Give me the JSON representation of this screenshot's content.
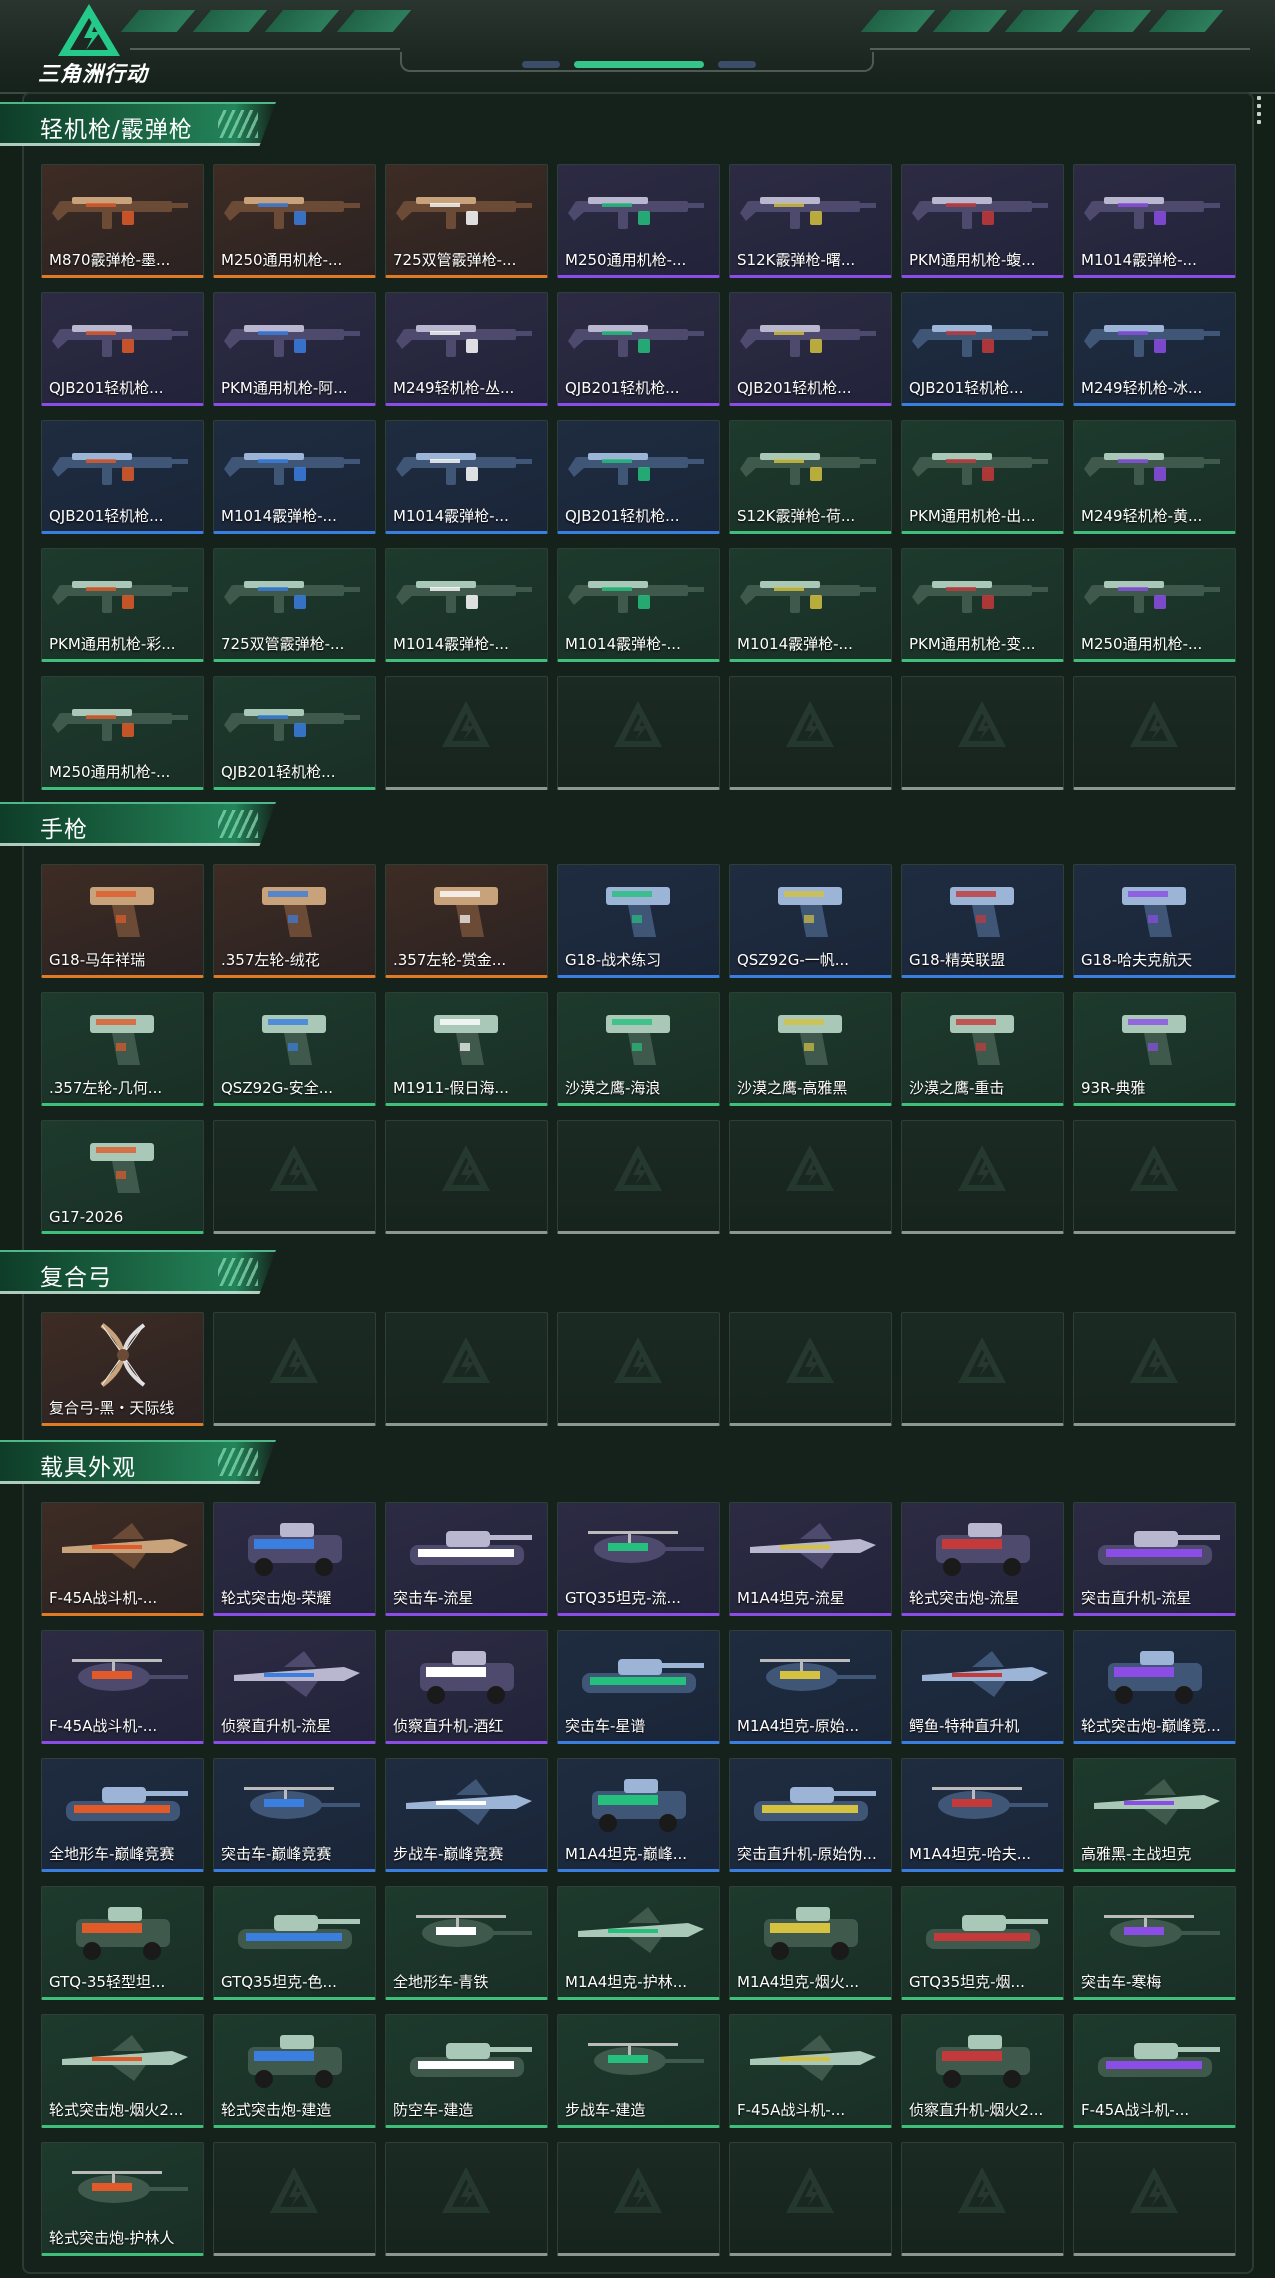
{
  "header": {
    "logo_text": "三角洲行动"
  },
  "colors": {
    "gold": "#e07b25",
    "purple": "#8c4de6",
    "blue": "#3a7ee0",
    "green": "#3fbf7a",
    "accent": "#22845a"
  },
  "sections": [
    {
      "title": "轻机枪/霰弹枪",
      "kind": "gun",
      "items": [
        {
          "name": "M870霰弹枪-墨...",
          "rarity": "gold"
        },
        {
          "name": "M250通用机枪-...",
          "rarity": "gold"
        },
        {
          "name": "725双管霰弹枪-...",
          "rarity": "gold"
        },
        {
          "name": "M250通用机枪-...",
          "rarity": "purple"
        },
        {
          "name": "S12K霰弹枪-曙...",
          "rarity": "purple"
        },
        {
          "name": "PKM通用机枪-蝮...",
          "rarity": "purple"
        },
        {
          "name": "M1014霰弹枪-...",
          "rarity": "purple"
        },
        {
          "name": "QJB201轻机枪...",
          "rarity": "purple"
        },
        {
          "name": "PKM通用机枪-阿...",
          "rarity": "purple"
        },
        {
          "name": "M249轻机枪-丛...",
          "rarity": "purple"
        },
        {
          "name": "QJB201轻机枪...",
          "rarity": "purple"
        },
        {
          "name": "QJB201轻机枪...",
          "rarity": "purple"
        },
        {
          "name": "QJB201轻机枪...",
          "rarity": "blue"
        },
        {
          "name": "M249轻机枪-冰...",
          "rarity": "blue"
        },
        {
          "name": "QJB201轻机枪...",
          "rarity": "blue"
        },
        {
          "name": "M1014霰弹枪-...",
          "rarity": "blue"
        },
        {
          "name": "M1014霰弹枪-...",
          "rarity": "blue"
        },
        {
          "name": "QJB201轻机枪...",
          "rarity": "blue"
        },
        {
          "name": "S12K霰弹枪-荷...",
          "rarity": "green"
        },
        {
          "name": "PKM通用机枪-出...",
          "rarity": "green"
        },
        {
          "name": "M249轻机枪-黄...",
          "rarity": "green"
        },
        {
          "name": "PKM通用机枪-彩...",
          "rarity": "green"
        },
        {
          "name": "725双管霰弹枪-...",
          "rarity": "green"
        },
        {
          "name": "M1014霰弹枪-...",
          "rarity": "green"
        },
        {
          "name": "M1014霰弹枪-...",
          "rarity": "green"
        },
        {
          "name": "M1014霰弹枪-...",
          "rarity": "green"
        },
        {
          "name": "PKM通用机枪-变...",
          "rarity": "green"
        },
        {
          "name": "M250通用机枪-...",
          "rarity": "green"
        },
        {
          "name": "M250通用机枪-...",
          "rarity": "green"
        },
        {
          "name": "QJB201轻机枪...",
          "rarity": "green"
        }
      ],
      "empty_slots": 5
    },
    {
      "title": "手枪",
      "kind": "pistol",
      "items": [
        {
          "name": "G18-马年祥瑞",
          "rarity": "gold"
        },
        {
          "name": ".357左轮-绒花",
          "rarity": "gold"
        },
        {
          "name": ".357左轮-赏金...",
          "rarity": "gold"
        },
        {
          "name": "G18-战术练习",
          "rarity": "blue"
        },
        {
          "name": "QSZ92G-一帆...",
          "rarity": "blue"
        },
        {
          "name": "G18-精英联盟",
          "rarity": "blue"
        },
        {
          "name": "G18-哈夫克航天",
          "rarity": "blue"
        },
        {
          "name": ".357左轮-几何...",
          "rarity": "green"
        },
        {
          "name": "QSZ92G-安全...",
          "rarity": "green"
        },
        {
          "name": "M1911-假日海...",
          "rarity": "green"
        },
        {
          "name": "沙漠之鹰-海浪",
          "rarity": "green"
        },
        {
          "name": "沙漠之鹰-高雅黑",
          "rarity": "green"
        },
        {
          "name": "沙漠之鹰-重击",
          "rarity": "green"
        },
        {
          "name": "93R-典雅",
          "rarity": "green"
        },
        {
          "name": "G17-2026",
          "rarity": "green"
        }
      ],
      "empty_slots": 6
    },
    {
      "title": "复合弓",
      "kind": "bow",
      "items": [
        {
          "name": "复合弓-黑・天际线",
          "rarity": "gold"
        }
      ],
      "empty_slots": 6
    },
    {
      "title": "载具外观",
      "kind": "vehicle",
      "items": [
        {
          "name": "F-45A战斗机-...",
          "rarity": "gold"
        },
        {
          "name": "轮式突击炮-荣耀",
          "rarity": "purple"
        },
        {
          "name": "突击车-流星",
          "rarity": "purple"
        },
        {
          "name": "GTQ35坦克-流...",
          "rarity": "purple"
        },
        {
          "name": "M1A4坦克-流星",
          "rarity": "purple"
        },
        {
          "name": "轮式突击炮-流星",
          "rarity": "purple"
        },
        {
          "name": "突击直升机-流星",
          "rarity": "purple"
        },
        {
          "name": "F-45A战斗机-...",
          "rarity": "purple"
        },
        {
          "name": "侦察直升机-流星",
          "rarity": "purple"
        },
        {
          "name": "侦察直升机-酒红",
          "rarity": "purple"
        },
        {
          "name": "突击车-星谱",
          "rarity": "blue"
        },
        {
          "name": "M1A4坦克-原始...",
          "rarity": "blue"
        },
        {
          "name": "鳄鱼-特种直升机",
          "rarity": "blue"
        },
        {
          "name": "轮式突击炮-巅峰竞...",
          "rarity": "blue"
        },
        {
          "name": "全地形车-巅峰竞赛",
          "rarity": "blue"
        },
        {
          "name": "突击车-巅峰竞赛",
          "rarity": "blue"
        },
        {
          "name": "步战车-巅峰竞赛",
          "rarity": "blue"
        },
        {
          "name": "M1A4坦克-巅峰...",
          "rarity": "blue"
        },
        {
          "name": "突击直升机-原始伪...",
          "rarity": "blue"
        },
        {
          "name": "M1A4坦克-哈夫...",
          "rarity": "blue"
        },
        {
          "name": "高雅黑-主战坦克",
          "rarity": "green"
        },
        {
          "name": "GTQ-35轻型坦...",
          "rarity": "green"
        },
        {
          "name": "GTQ35坦克-色...",
          "rarity": "green"
        },
        {
          "name": "全地形车-青铁",
          "rarity": "green"
        },
        {
          "name": "M1A4坦克-护林...",
          "rarity": "green"
        },
        {
          "name": "M1A4坦克-烟火...",
          "rarity": "green"
        },
        {
          "name": "GTQ35坦克-烟...",
          "rarity": "green"
        },
        {
          "name": "突击车-寒梅",
          "rarity": "green"
        },
        {
          "name": "轮式突击炮-烟火2...",
          "rarity": "green"
        },
        {
          "name": "轮式突击炮-建造",
          "rarity": "green"
        },
        {
          "name": "防空车-建造",
          "rarity": "green"
        },
        {
          "name": "步战车-建造",
          "rarity": "green"
        },
        {
          "name": "F-45A战斗机-...",
          "rarity": "green"
        },
        {
          "name": "侦察直升机-烟火2...",
          "rarity": "green"
        },
        {
          "name": "F-45A战斗机-...",
          "rarity": "green"
        },
        {
          "name": "轮式突击炮-护林人",
          "rarity": "green"
        }
      ],
      "empty_slots": 6
    }
  ]
}
